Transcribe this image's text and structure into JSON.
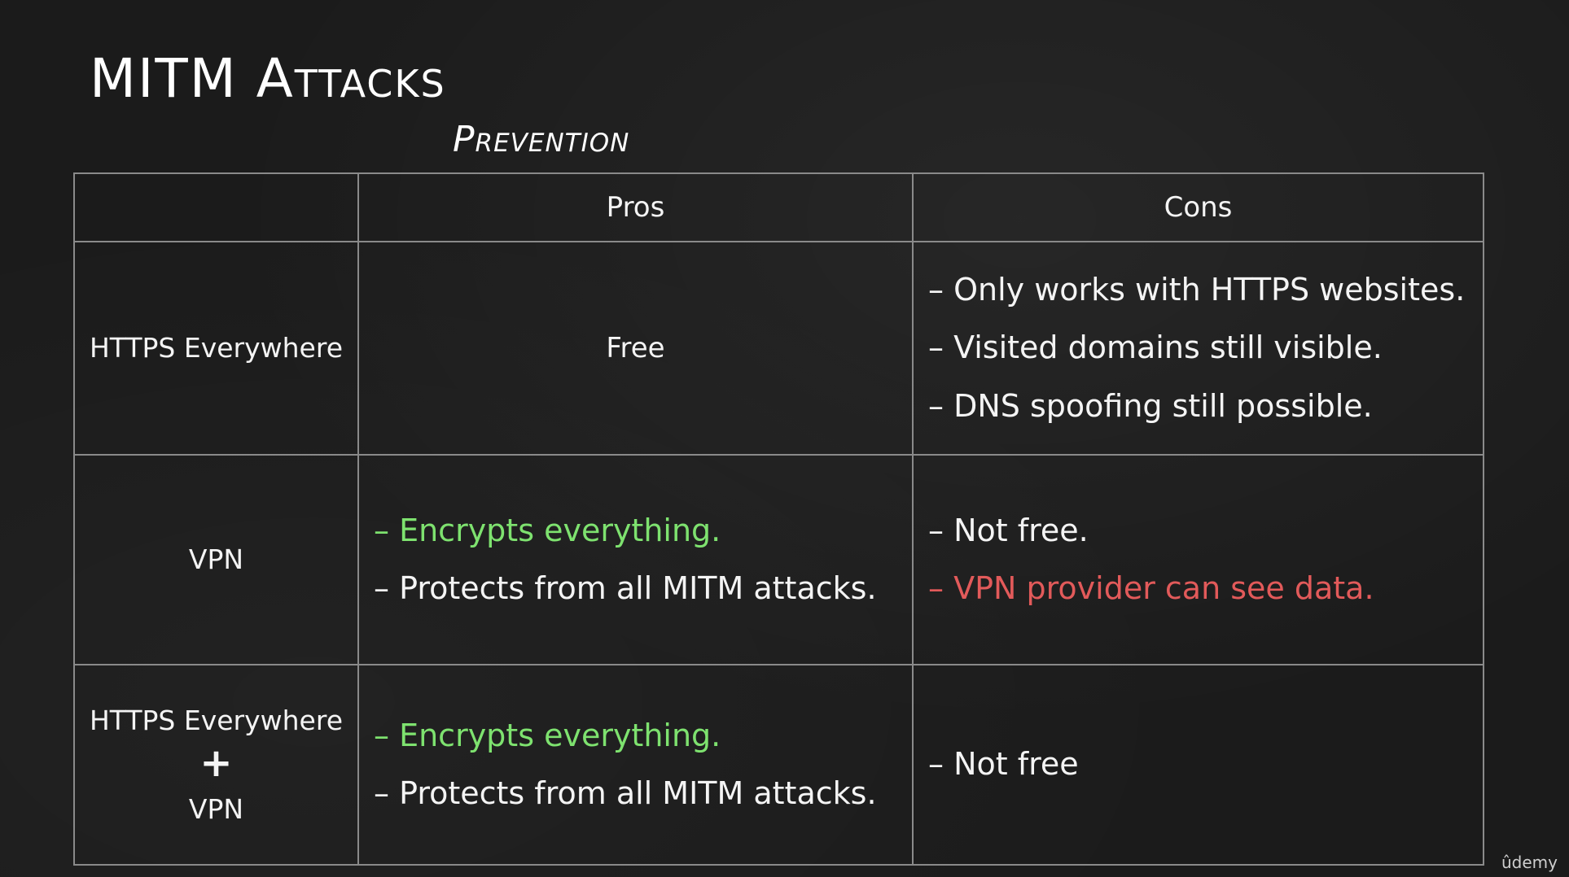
{
  "slide": {
    "title": "MITM Attacks",
    "subtitle": "Prevention"
  },
  "table": {
    "headers": [
      "",
      "Pros",
      "Cons"
    ],
    "rows": [
      {
        "label": [
          "HTTPS Everywhere"
        ],
        "pros": [
          "Free"
        ],
        "cons": [
          "– Only works with HTTPS websites.",
          "– Visited domains still visible.",
          "– DNS spoofing still possible."
        ]
      },
      {
        "label": [
          "VPN"
        ],
        "pros": [
          "– Encrypts everything.",
          "– Protects from all MITM attacks."
        ],
        "cons": [
          "– Not free.",
          "– VPN provider can see data."
        ]
      },
      {
        "label": [
          "HTTPS Everywhere",
          "+",
          "VPN"
        ],
        "pros": [
          "– Encrypts everything.",
          "– Protects from all MITM attacks."
        ],
        "cons": [
          "– Not free"
        ]
      }
    ]
  },
  "colors": {
    "background": "#1b1b1b",
    "text": "#f4f4f4",
    "grid": "#8a8a8a",
    "positive": "#7ee26f",
    "negative": "#e25a5a"
  },
  "watermark": "ûdemy"
}
